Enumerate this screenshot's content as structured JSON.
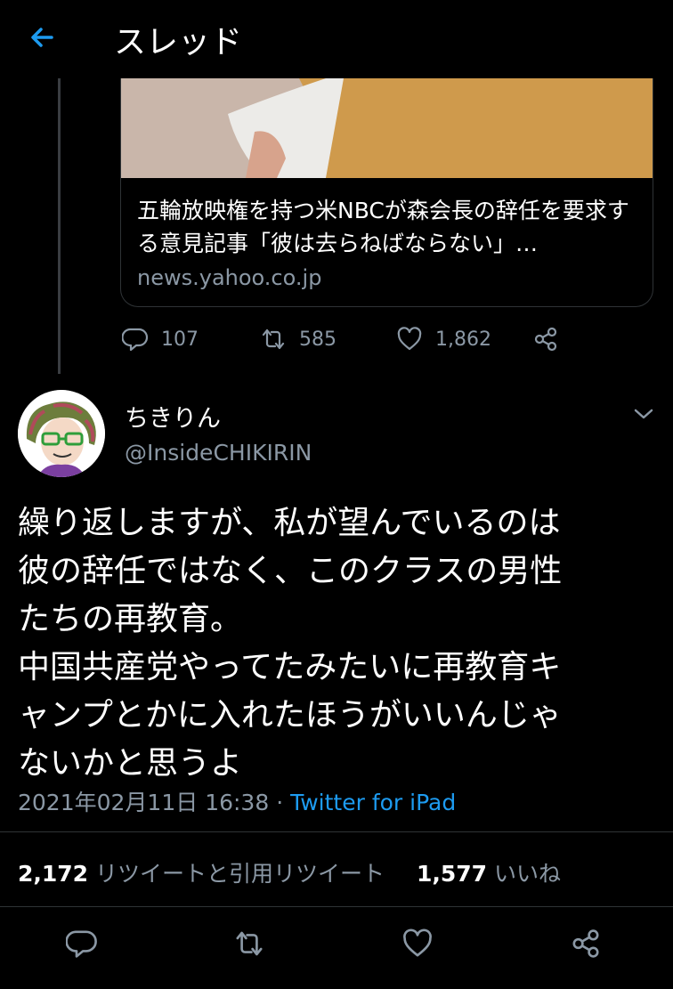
{
  "header": {
    "title": "スレッド"
  },
  "link_card": {
    "title": "五輪放映権を持つ米NBCが森会長の辞任を要求する意見記事「彼は去らねばならない」…",
    "domain": "news.yahoo.co.jp"
  },
  "quoted_actions": {
    "replies": "107",
    "retweets": "585",
    "likes": "1,862"
  },
  "tweet": {
    "display_name": "ちきりん",
    "handle": "@InsideCHIKIRIN",
    "lines": [
      "繰り返しますが、私が望んでいるのは",
      "彼の辞任ではなく、このクラスの男性",
      "たちの再教育。",
      "中国共産党やってたみたいに再教育キ",
      "ャンプとかに入れたほうがいいんじゃ",
      "ないかと思うよ"
    ],
    "timestamp": "2021年02月11日 16:38",
    "separator": " · ",
    "source": "Twitter for iPad",
    "retweet_count": "2,172",
    "retweet_label": " リツイートと引用リツイート",
    "like_count": "1,577",
    "like_label": " いいね"
  },
  "colors": {
    "accent": "#1d9bf0",
    "muted": "#8b98a5",
    "background": "#000000"
  }
}
